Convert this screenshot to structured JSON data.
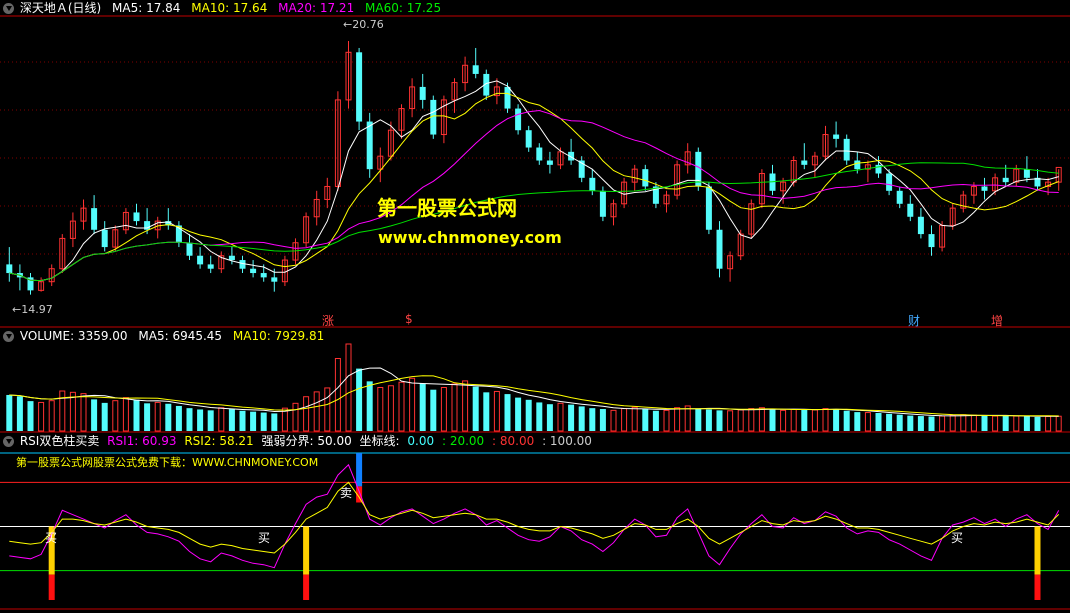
{
  "price_header": {
    "title": "深天地Ａ(日线)",
    "ma5": "MA5: 17.84",
    "ma10": "MA10: 17.64",
    "ma20": "MA20: 17.21",
    "ma60": "MA60: 17.25"
  },
  "volume_header": {
    "volume": "VOLUME: 3359.00",
    "ma5": "MA5: 6945.45",
    "ma10": "MA10: 7929.81"
  },
  "rsi_header": {
    "title": "RSI双色柱买卖",
    "rsi1": "RSI1: 60.93",
    "rsi2": "RSI2: 58.21",
    "divider": "强弱分界: 50.00",
    "axis_label": "坐标线:",
    "v0": "0.00",
    "v20": ": 20.00",
    "v80": ": 80.00",
    "v100": ": 100.00"
  },
  "watermark": {
    "title": "第一股票公式网",
    "url": "www.chnmoney.com"
  },
  "rsi_banner": "第一股票公式网股票公式免费下载：WWW.CHNMONEY.COM",
  "price_labels": {
    "high": "20.76",
    "low": "14.97"
  },
  "event_markers": [
    "涨",
    "$",
    "财",
    "增"
  ],
  "signal_labels": {
    "buy": "买",
    "sell": "卖"
  },
  "colors": {
    "up": "#ff3232",
    "down": "#54fcfc",
    "ma5": "#ffffff",
    "ma10": "#ffff00",
    "ma20": "#ff00ff",
    "ma60": "#00e000",
    "frame": "#c00000"
  },
  "chart_data": [
    {
      "type": "candlestick",
      "title": "深天地Ａ(日线)",
      "high_mark": 20.76,
      "low_mark": 14.97,
      "ylim": [
        14.5,
        21.2
      ],
      "ohlc": [
        [
          15.6,
          16.0,
          15.2,
          15.4
        ],
        [
          15.4,
          15.6,
          15.0,
          15.3
        ],
        [
          15.3,
          15.4,
          14.9,
          15.0
        ],
        [
          15.0,
          15.3,
          14.97,
          15.2
        ],
        [
          15.2,
          15.6,
          15.1,
          15.5
        ],
        [
          15.5,
          16.3,
          15.4,
          16.2
        ],
        [
          16.2,
          16.8,
          16.0,
          16.6
        ],
        [
          16.6,
          17.1,
          16.4,
          16.9
        ],
        [
          16.9,
          17.2,
          16.3,
          16.4
        ],
        [
          16.4,
          16.6,
          15.9,
          16.0
        ],
        [
          16.0,
          16.5,
          15.9,
          16.4
        ],
        [
          16.4,
          16.9,
          16.3,
          16.8
        ],
        [
          16.8,
          17.0,
          16.5,
          16.6
        ],
        [
          16.6,
          16.9,
          16.3,
          16.4
        ],
        [
          16.4,
          16.7,
          16.2,
          16.6
        ],
        [
          16.6,
          16.9,
          16.4,
          16.5
        ],
        [
          16.5,
          16.6,
          16.0,
          16.1
        ],
        [
          16.1,
          16.3,
          15.7,
          15.8
        ],
        [
          15.8,
          16.0,
          15.5,
          15.6
        ],
        [
          15.6,
          15.8,
          15.4,
          15.5
        ],
        [
          15.5,
          15.9,
          15.4,
          15.8
        ],
        [
          15.8,
          16.0,
          15.6,
          15.7
        ],
        [
          15.7,
          15.8,
          15.4,
          15.5
        ],
        [
          15.5,
          15.7,
          15.3,
          15.4
        ],
        [
          15.4,
          15.6,
          15.2,
          15.3
        ],
        [
          15.3,
          15.5,
          14.97,
          15.2
        ],
        [
          15.2,
          15.8,
          15.1,
          15.7
        ],
        [
          15.7,
          16.2,
          15.6,
          16.1
        ],
        [
          16.1,
          16.8,
          16.0,
          16.7
        ],
        [
          16.7,
          17.3,
          16.5,
          17.1
        ],
        [
          17.1,
          17.6,
          16.9,
          17.4
        ],
        [
          17.4,
          19.6,
          17.3,
          19.4
        ],
        [
          19.4,
          20.76,
          19.2,
          20.5
        ],
        [
          20.5,
          20.6,
          18.7,
          18.9
        ],
        [
          18.9,
          19.1,
          17.6,
          17.8
        ],
        [
          17.8,
          18.3,
          17.5,
          18.1
        ],
        [
          18.1,
          18.9,
          18.0,
          18.7
        ],
        [
          18.7,
          19.3,
          18.5,
          19.2
        ],
        [
          19.2,
          19.9,
          19.0,
          19.7
        ],
        [
          19.7,
          20.0,
          19.2,
          19.4
        ],
        [
          19.4,
          19.5,
          18.5,
          18.6
        ],
        [
          18.6,
          19.5,
          18.4,
          19.4
        ],
        [
          19.4,
          19.9,
          19.1,
          19.8
        ],
        [
          19.8,
          20.4,
          19.6,
          20.2
        ],
        [
          20.2,
          20.6,
          19.9,
          20.0
        ],
        [
          20.0,
          20.1,
          19.4,
          19.5
        ],
        [
          19.5,
          19.9,
          19.3,
          19.7
        ],
        [
          19.7,
          19.8,
          19.1,
          19.2
        ],
        [
          19.2,
          19.3,
          18.6,
          18.7
        ],
        [
          18.7,
          18.8,
          18.2,
          18.3
        ],
        [
          18.3,
          18.4,
          17.9,
          18.0
        ],
        [
          18.0,
          18.2,
          17.7,
          17.9
        ],
        [
          17.9,
          18.3,
          17.8,
          18.2
        ],
        [
          18.2,
          18.5,
          17.9,
          18.0
        ],
        [
          18.0,
          18.1,
          17.5,
          17.6
        ],
        [
          17.6,
          17.8,
          17.2,
          17.3
        ],
        [
          17.3,
          17.4,
          16.6,
          16.7
        ],
        [
          16.7,
          17.1,
          16.5,
          17.0
        ],
        [
          17.0,
          17.6,
          16.9,
          17.5
        ],
        [
          17.5,
          17.9,
          17.3,
          17.8
        ],
        [
          17.8,
          17.9,
          17.3,
          17.4
        ],
        [
          17.4,
          17.5,
          16.9,
          17.0
        ],
        [
          17.0,
          17.3,
          16.8,
          17.2
        ],
        [
          17.2,
          18.0,
          17.1,
          17.9
        ],
        [
          17.9,
          18.4,
          17.7,
          18.2
        ],
        [
          18.2,
          18.3,
          17.3,
          17.4
        ],
        [
          17.4,
          17.5,
          16.3,
          16.4
        ],
        [
          16.4,
          16.6,
          15.3,
          15.5
        ],
        [
          15.5,
          15.9,
          15.2,
          15.8
        ],
        [
          15.8,
          16.4,
          15.7,
          16.3
        ],
        [
          16.3,
          17.1,
          16.2,
          17.0
        ],
        [
          17.0,
          17.8,
          16.9,
          17.7
        ],
        [
          17.7,
          17.9,
          17.2,
          17.3
        ],
        [
          17.3,
          17.6,
          17.0,
          17.5
        ],
        [
          17.5,
          18.1,
          17.4,
          18.0
        ],
        [
          18.0,
          18.4,
          17.8,
          17.9
        ],
        [
          17.9,
          18.2,
          17.6,
          18.1
        ],
        [
          18.1,
          18.8,
          18.0,
          18.6
        ],
        [
          18.6,
          18.9,
          18.3,
          18.5
        ],
        [
          18.5,
          18.6,
          17.9,
          18.0
        ],
        [
          18.0,
          18.2,
          17.7,
          17.8
        ],
        [
          17.8,
          18.0,
          17.5,
          17.9
        ],
        [
          17.9,
          18.1,
          17.6,
          17.7
        ],
        [
          17.7,
          17.8,
          17.2,
          17.3
        ],
        [
          17.3,
          17.4,
          16.9,
          17.0
        ],
        [
          17.0,
          17.2,
          16.6,
          16.7
        ],
        [
          16.7,
          16.9,
          16.2,
          16.3
        ],
        [
          16.3,
          16.5,
          15.8,
          16.0
        ],
        [
          16.0,
          16.6,
          15.9,
          16.5
        ],
        [
          16.5,
          17.0,
          16.4,
          16.9
        ],
        [
          16.9,
          17.3,
          16.8,
          17.2
        ],
        [
          17.2,
          17.5,
          17.0,
          17.4
        ],
        [
          17.4,
          17.6,
          17.1,
          17.3
        ],
        [
          17.3,
          17.7,
          17.2,
          17.6
        ],
        [
          17.6,
          17.9,
          17.4,
          17.5
        ],
        [
          17.5,
          17.9,
          17.4,
          17.8
        ],
        [
          17.8,
          18.1,
          17.5,
          17.6
        ],
        [
          17.6,
          17.8,
          17.3,
          17.4
        ],
        [
          17.4,
          17.6,
          17.2,
          17.5
        ],
        [
          17.5,
          17.8,
          17.3,
          17.84
        ]
      ],
      "ma_periods": [
        5,
        10,
        20,
        60
      ],
      "ma_values": {
        "MA5": 17.84,
        "MA10": 17.64,
        "MA20": 17.21,
        "MA60": 17.25
      }
    },
    {
      "type": "bar",
      "title": "VOLUME",
      "values": [
        8200,
        7900,
        6800,
        6500,
        6900,
        9100,
        8800,
        8500,
        7200,
        6400,
        6900,
        7600,
        7100,
        6300,
        6500,
        6200,
        5700,
        5200,
        4900,
        4700,
        5300,
        5000,
        4600,
        4400,
        4200,
        4000,
        5200,
        6300,
        7800,
        8900,
        9800,
        16500,
        19800,
        14200,
        11300,
        9900,
        10300,
        11100,
        12000,
        10800,
        9400,
        9900,
        10700,
        11400,
        10100,
        8800,
        9000,
        8400,
        7600,
        7100,
        6500,
        6100,
        6300,
        6000,
        5600,
        5200,
        5000,
        4700,
        5100,
        5400,
        5000,
        4600,
        4700,
        5300,
        5700,
        5100,
        4900,
        4700,
        4600,
        4800,
        5100,
        5300,
        4900,
        4700,
        4900,
        5000,
        4800,
        5100,
        4900,
        4600,
        4300,
        4200,
        4100,
        3900,
        3700,
        3500,
        3400,
        3300,
        3400,
        3600,
        3700,
        3600,
        3500,
        3400,
        3500,
        3400,
        3300,
        3200,
        3300,
        3359
      ],
      "ma_values": {
        "MA5": 6945.45,
        "MA10": 7929.81
      }
    },
    {
      "type": "line",
      "title": "RSI双色柱买卖",
      "ylim": [
        0,
        100
      ],
      "reference_lines": [
        0,
        20,
        50,
        80,
        100
      ],
      "series": [
        {
          "name": "RSI1",
          "values": [
            30,
            29,
            28,
            31,
            45,
            61,
            58,
            55,
            52,
            49,
            54,
            58,
            51,
            46,
            45,
            43,
            40,
            33,
            28,
            26,
            32,
            30,
            27,
            25,
            24,
            22,
            38,
            52,
            65,
            70,
            72,
            85,
            92,
            74,
            55,
            51,
            56,
            60,
            62,
            57,
            52,
            55,
            59,
            62,
            58,
            51,
            54,
            49,
            44,
            41,
            40,
            43,
            50,
            47,
            41,
            38,
            33,
            39,
            48,
            55,
            51,
            43,
            44,
            56,
            62,
            46,
            30,
            24,
            35,
            45,
            52,
            58,
            50,
            49,
            56,
            52,
            54,
            60,
            57,
            49,
            45,
            47,
            46,
            41,
            38,
            34,
            30,
            27,
            42,
            51,
            53,
            56,
            52,
            55,
            50,
            55,
            58,
            52,
            48,
            60.93
          ]
        },
        {
          "name": "RSI2",
          "values": [
            40,
            39,
            38,
            39,
            46,
            55,
            55,
            54,
            52,
            51,
            53,
            55,
            53,
            50,
            49,
            48,
            46,
            42,
            38,
            36,
            38,
            37,
            35,
            34,
            33,
            32,
            38,
            46,
            55,
            59,
            63,
            74,
            80,
            70,
            58,
            55,
            57,
            59,
            61,
            59,
            56,
            57,
            58,
            59,
            58,
            55,
            55,
            53,
            50,
            48,
            47,
            47,
            50,
            49,
            47,
            45,
            42,
            44,
            48,
            52,
            51,
            48,
            48,
            52,
            55,
            50,
            42,
            38,
            42,
            46,
            50,
            54,
            52,
            51,
            54,
            53,
            54,
            57,
            55,
            52,
            49,
            49,
            48,
            46,
            44,
            42,
            40,
            38,
            42,
            47,
            50,
            52,
            51,
            53,
            52,
            53,
            55,
            53,
            51,
            58.21
          ]
        }
      ],
      "buy_signals": [
        4,
        28,
        97
      ],
      "sell_signals": [
        33
      ]
    }
  ]
}
